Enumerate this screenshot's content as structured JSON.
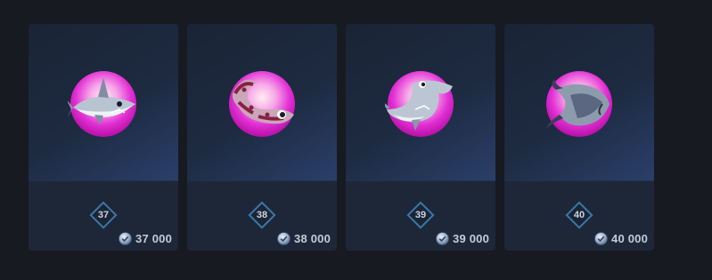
{
  "cards": [
    {
      "level": "37",
      "xp": "37 000",
      "emblem": "shark-emblem-icon"
    },
    {
      "level": "38",
      "xp": "38 000",
      "emblem": "eel-emblem-icon"
    },
    {
      "level": "39",
      "xp": "39 000",
      "emblem": "hammerhead-emblem-icon"
    },
    {
      "level": "40",
      "xp": "40 000",
      "emblem": "manta-ray-emblem-icon"
    }
  ],
  "colors": {
    "background": "#171a21",
    "card": "#1d2738",
    "accent_magenta": "#e020d0",
    "badge_border": "#3a78a8"
  }
}
